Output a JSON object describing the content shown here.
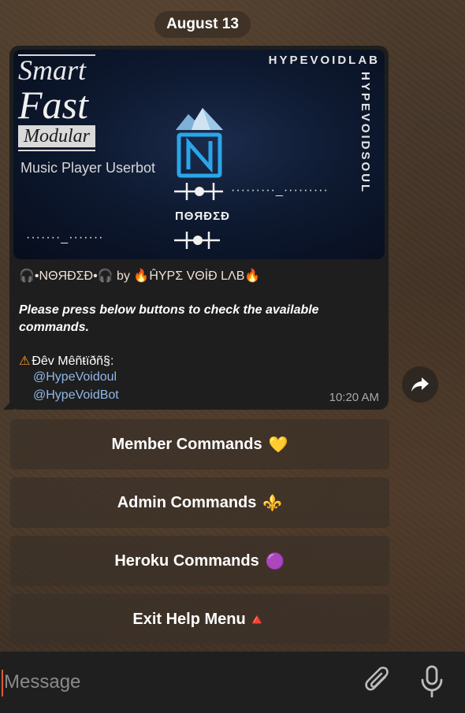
{
  "date_label": "August 13",
  "banner": {
    "line_smart": "Smart",
    "line_fast": "Fast",
    "line_modular": "Modular",
    "subtitle": "Music Player Userbot",
    "brand_top": "HYPEVOIDLAB",
    "brand_side": "HYPEVOIDSOUL",
    "logo_text": "ПΘЯÐΣÐ",
    "dots_right": "·········_·········",
    "dots_left": "·······_·······"
  },
  "message": {
    "caption_name": "🎧•ΝΘЯÐΣÐ•🎧",
    "caption_by": " by ",
    "caption_fire_left": "🔥",
    "caption_lab": "ĤΥΡΣ VΘİÐ LΛB",
    "caption_fire_right": "🔥",
    "press_text": "Please press below buttons to check the available commands.",
    "dev_icon": "⚠",
    "dev_label": "Đêv Mêñŧïðñ§:",
    "link1": "@HypeVoidoul",
    "link2": "@HypeVoidBot",
    "time": "10:20 AM"
  },
  "buttons": {
    "member": {
      "label": "Member Commands",
      "emoji": "💛"
    },
    "admin": {
      "label": "Admin Commands",
      "emoji": "⚜️"
    },
    "heroku": {
      "label": "Heroku Commands",
      "emoji": "🟣"
    },
    "exit": {
      "label": "Exit Help Menu",
      "emoji": "🔺"
    }
  },
  "composer": {
    "placeholder": "Message"
  },
  "icons": {
    "share": "share-arrow-icon",
    "attach": "paperclip-icon",
    "mic": "microphone-icon"
  },
  "colors": {
    "link": "#8fb8e8",
    "bubble": "#1e1e1e",
    "accent_cursor": "#e05a3a"
  }
}
